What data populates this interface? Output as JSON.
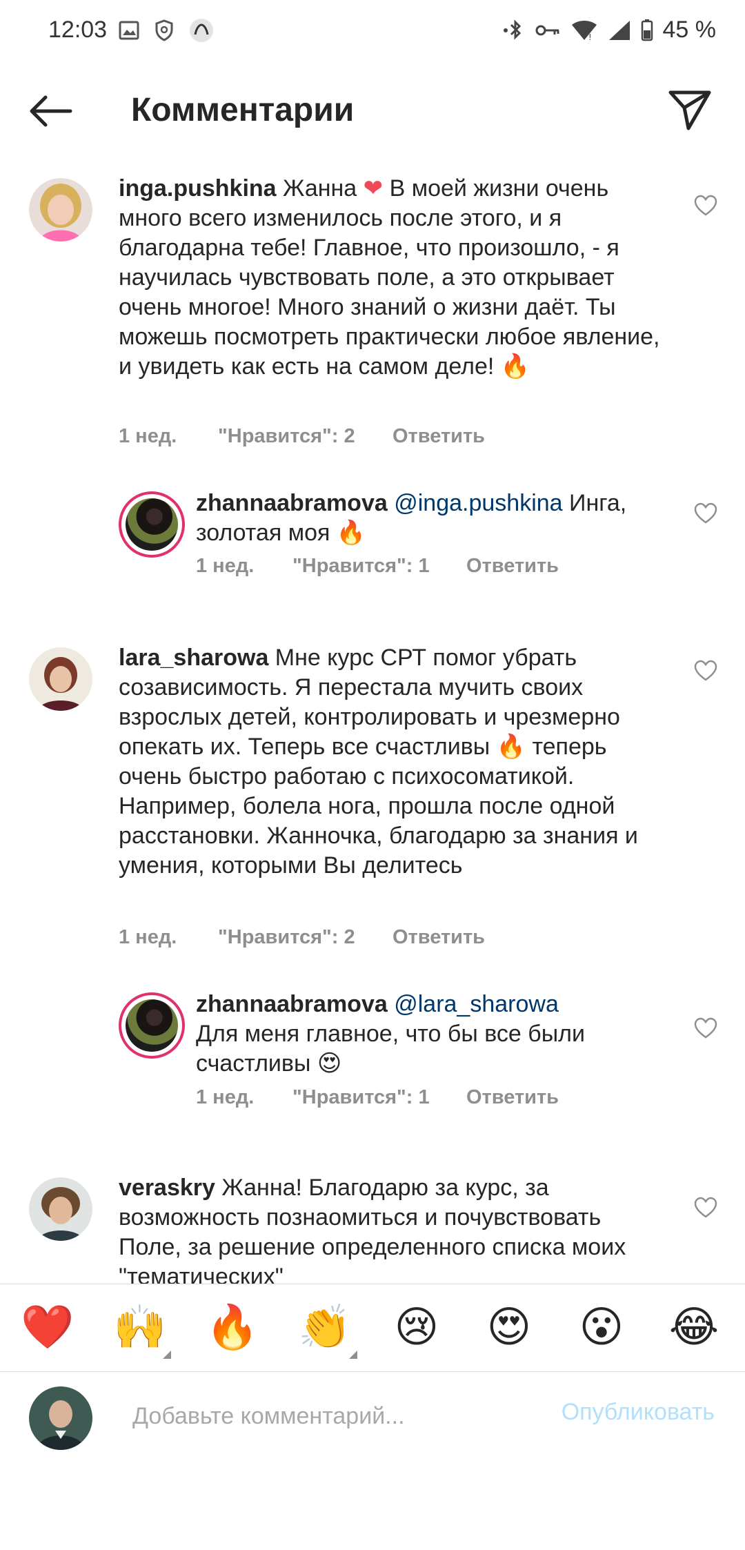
{
  "status_bar": {
    "time": "12:03",
    "battery": "45 %"
  },
  "header": {
    "title": "Комментарии"
  },
  "comments": [
    {
      "username": "inga.pushkina",
      "text_before": "Жанна ",
      "text_after": " В моей жизни очень много всего изменилось после этого, и я благодарна тебе! Главное, что произошло, - я научилась чувствовать поле, а это открывает очень многое! Много знаний о жизни даёт. Ты можешь посмотреть практически любое явление, и увидеть как есть на самом деле! ",
      "heart_emoji": "❤",
      "end_emoji": "🔥",
      "time": "1 нед.",
      "likes": "\"Нравится\": 2",
      "reply": "Ответить"
    },
    {
      "username": "zhannaabramova",
      "mention": "@inga.pushkina",
      "text": " Инга, золотая моя ",
      "end_emoji": "🔥",
      "time": "1 нед.",
      "likes": "\"Нравится\": 1",
      "reply": "Ответить"
    },
    {
      "username": "lara_sharowa",
      "text_before": " Мне курс СРТ помог убрать созависимость. Я перестала мучить своих взрослых детей, контролировать и чрезмерно опекать их. Теперь все счастливы ",
      "mid_emoji": "🔥",
      "text_after": " теперь очень быстро работаю с психосоматикой. Например, болела нога, прошла после одной расстановки. Жанночка, благодарю за знания и умения, которыми Вы делитесь",
      "time": "1 нед.",
      "likes": "\"Нравится\": 2",
      "reply": "Ответить"
    },
    {
      "username": "zhannaabramova",
      "mention": "@lara_sharowa",
      "text": "Для меня главное, что бы все были счастливы ",
      "end_emoji": "😍",
      "time": "1 нед.",
      "likes": "\"Нравится\": 1",
      "reply": "Ответить"
    },
    {
      "username": "veraskry",
      "text": " Жанна! Благодарю за курс, за возможность познаомиться и почувствовать Поле, за решение определенного списка моих \"тематических\""
    }
  ],
  "reactions": [
    "❤️",
    "🙌",
    "🔥",
    "👏",
    "😢",
    "😍",
    "😮",
    "😂"
  ],
  "input": {
    "placeholder": "Добавьте комментарий...",
    "publish_label": "Опубликовать"
  },
  "colors": {
    "text": "#262626",
    "meta": "#8e8e8e",
    "mention": "#00376b",
    "publish_disabled": "#b2dffc",
    "heart_red": "#ed4956"
  }
}
